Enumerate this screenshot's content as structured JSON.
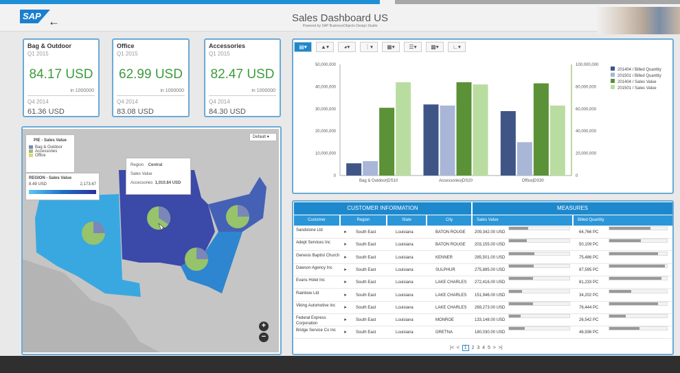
{
  "header": {
    "logo": "SAP",
    "title": "Sales Dashboard US",
    "subtitle": "Powered by SAP BusinessObjects Design Studio"
  },
  "kpis": [
    {
      "name": "Bag & Outdoor",
      "period": "Q1 2015",
      "value": "84.17 USD",
      "unit": "in 1000000",
      "prev_period": "Q4 2014",
      "prev_value": "61.36 USD"
    },
    {
      "name": "Office",
      "period": "Q1 2015",
      "value": "62.99 USD",
      "unit": "in 1000000",
      "prev_period": "Q4 2014",
      "prev_value": "83.08 USD"
    },
    {
      "name": "Accessories",
      "period": "Q1 2015",
      "value": "82.47 USD",
      "unit": "in 1000000",
      "prev_period": "Q4 2014",
      "prev_value": "84.30 USD"
    }
  ],
  "map": {
    "pie_legend_title": "PIE - Sales Value",
    "pie_legend_items": [
      {
        "label": "Bag & Outdoor",
        "color": "#7b87b8"
      },
      {
        "label": "Accessories",
        "color": "#97c36b"
      },
      {
        "label": "Office",
        "color": "#e3d17a"
      }
    ],
    "region_legend_title": "REGION - Sales Value",
    "region_min": "8.49 USD",
    "region_max": "2,173.67",
    "dropdown": "Default",
    "tooltip": {
      "region_label": "Region",
      "region_value": "Central",
      "sales_label": "Sales Value",
      "acc_label": "Accessories",
      "acc_value": "1,010.84 USD"
    },
    "zoom_in": "+",
    "zoom_out": "−"
  },
  "toolbar": [
    "bar-chart-icon",
    "area-chart-icon",
    "pie-chart-icon",
    "scatter-icon",
    "map-icon",
    "sort-icon",
    "stack-icon",
    "axis-icon"
  ],
  "chart_data": {
    "type": "bar",
    "categories": [
      "Bag & Outdoor|DS10",
      "Accessories|DS20",
      "Office|DS30"
    ],
    "series": [
      {
        "name": "201404 / Billed Quantity",
        "axis": "left",
        "color": "#3e5586",
        "values": [
          5500000,
          32000000,
          29000000
        ]
      },
      {
        "name": "201501 / Billed Quantity",
        "axis": "left",
        "color": "#a9b6d8",
        "values": [
          6500000,
          31500000,
          15000000
        ]
      },
      {
        "name": "201404 / Sales Value",
        "axis": "right",
        "color": "#5b9137",
        "values": [
          61000000,
          84000000,
          83000000
        ]
      },
      {
        "name": "201501 / Sales Value",
        "axis": "right",
        "color": "#b9dda0",
        "values": [
          84000000,
          82000000,
          63000000
        ]
      }
    ],
    "yticks_left": [
      "0",
      "10,000,000",
      "20,000,000",
      "30,000,000",
      "40,000,000",
      "50,000,000"
    ],
    "yticks_right": [
      "0",
      "20,000,000",
      "40,000,000",
      "60,000,000",
      "80,000,000",
      "100,000,000"
    ],
    "ylim_left": [
      0,
      50000000
    ],
    "ylim_right": [
      0,
      100000000
    ]
  },
  "table": {
    "group1": "CUSTOMER INFORMATION",
    "group2": "MEASURES",
    "columns": [
      "Customer",
      "Region",
      "State",
      "City",
      "Sales Value",
      "Billed Quantity"
    ],
    "rows": [
      {
        "customer": "Sandstone Ltd",
        "region": "South East",
        "state": "Louisiana",
        "city": "BATON ROUGE",
        "sales": "209,342.00 USD",
        "sales_frac": 0.32,
        "qty": "64,766 PC",
        "qty_frac": 0.72
      },
      {
        "customer": "Adept Services Inc",
        "region": "South East",
        "state": "Louisiana",
        "city": "BATON ROUGE",
        "sales": "203,155.00 USD",
        "sales_frac": 0.3,
        "qty": "50,109 PC",
        "qty_frac": 0.55
      },
      {
        "customer": "Genesis Baptist Church",
        "region": "South East",
        "state": "Louisiana",
        "city": "KENNER",
        "sales": "285,501.00 USD",
        "sales_frac": 0.42,
        "qty": "75,486 PC",
        "qty_frac": 0.84
      },
      {
        "customer": "Dawson Agency Inc",
        "region": "South East",
        "state": "Louisiana",
        "city": "SULPHUR",
        "sales": "275,885.00 USD",
        "sales_frac": 0.41,
        "qty": "87,595 PC",
        "qty_frac": 0.97
      },
      {
        "customer": "Evans Hotel Inc",
        "region": "South East",
        "state": "Louisiana",
        "city": "LAKE CHARLES",
        "sales": "272,416.00 USD",
        "sales_frac": 0.4,
        "qty": "81,233 PC",
        "qty_frac": 0.9
      },
      {
        "customer": "Rainbow Ltd",
        "region": "South East",
        "state": "Louisiana",
        "city": "LAKE CHARLES",
        "sales": "151,946.00 USD",
        "sales_frac": 0.22,
        "qty": "34,202 PC",
        "qty_frac": 0.38
      },
      {
        "customer": "Viking Automotive Inc",
        "region": "South East",
        "state": "Louisiana",
        "city": "LAKE CHARLES",
        "sales": "269,273.00 USD",
        "sales_frac": 0.4,
        "qty": "76,444 PC",
        "qty_frac": 0.85
      },
      {
        "customer": "Federal Express Corporation",
        "region": "South East",
        "state": "Louisiana",
        "city": "MONROE",
        "sales": "133,148.00 USD",
        "sales_frac": 0.19,
        "qty": "26,542 PC",
        "qty_frac": 0.29
      },
      {
        "customer": "Bridge Service Co Inc",
        "region": "South East",
        "state": "Louisiana",
        "city": "GRETNA",
        "sales": "180,030.00 USD",
        "sales_frac": 0.26,
        "qty": "46,936 PC",
        "qty_frac": 0.52
      }
    ],
    "pager": [
      "|<",
      "<",
      "1",
      "2",
      "3",
      "4",
      "5",
      ">",
      ">|"
    ]
  }
}
